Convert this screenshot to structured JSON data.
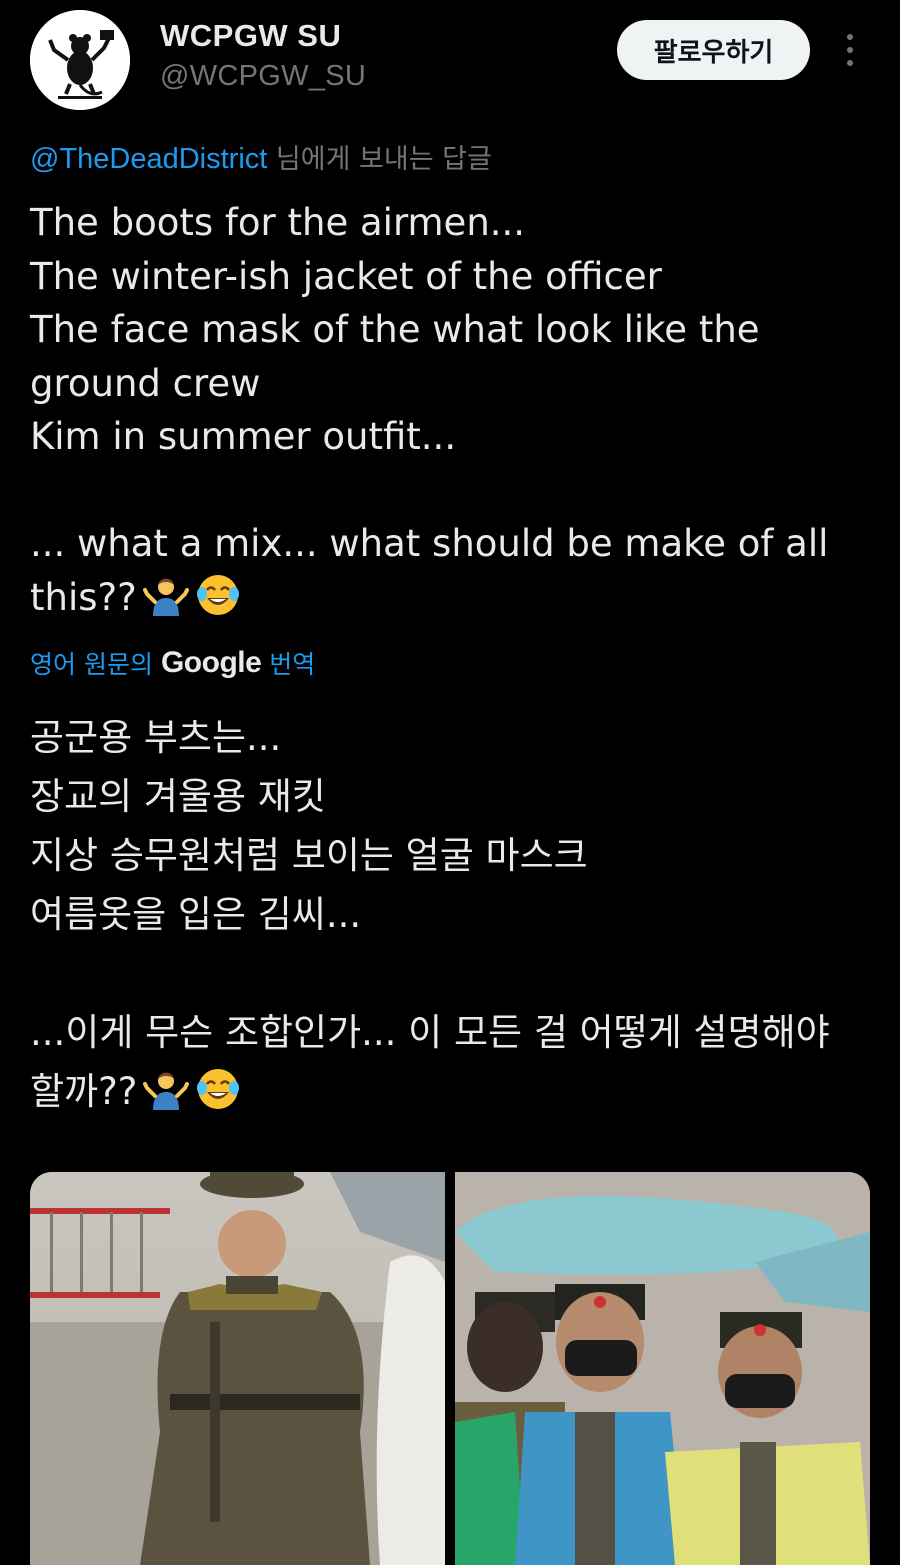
{
  "author": {
    "display_name": "WCPGW SU",
    "handle": "@WCPGW_SU",
    "avatar_icon": "banksy-rat-icon"
  },
  "actions": {
    "follow_label": "팔로우하기",
    "more_icon": "more-vertical-icon"
  },
  "reply_context": {
    "mention": "@TheDeadDistrict",
    "suffix": " 님에게 보내는 답글"
  },
  "tweet": {
    "lines": [
      "The boots for the airmen...",
      "The winter-ish jacket of the officer",
      "The face mask of the what look like the",
      "ground crew",
      "Kim in summer outfit...",
      "",
      "... what a mix... what should be make of all",
      "this??"
    ],
    "emojis": [
      "person-shrugging-emoji",
      "tears-of-joy-emoji"
    ]
  },
  "translation": {
    "prefix": "영어 원문의",
    "provider": "Google",
    "suffix": "번역",
    "lines": [
      "공군용 부츠는...",
      "장교의 겨울용 재킷",
      "지상 승무원처럼 보이는 얼굴 마스크",
      "여름옷을 입은 김씨...",
      "",
      "...이게 무슨 조합인가... 이 모든 걸 어떻게 설명해야",
      "할까??"
    ]
  },
  "media": [
    {
      "name": "photo-officer-in-winter-jacket"
    },
    {
      "name": "photo-ground-crew-in-face-masks"
    }
  ],
  "colors": {
    "background": "#000000",
    "text": "#e7e9ea",
    "muted": "#71767b",
    "link": "#1d9bf0",
    "follow_bg": "#eff3f4"
  }
}
